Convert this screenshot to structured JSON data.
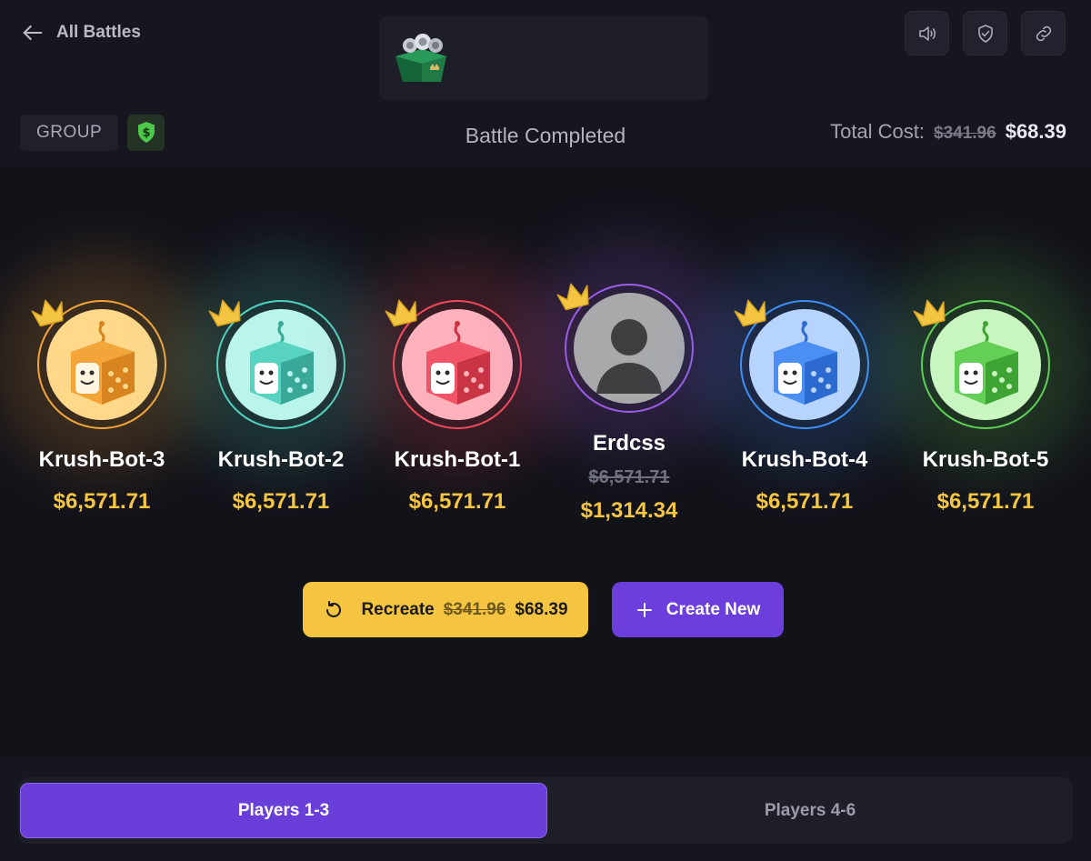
{
  "header": {
    "back_label": "All Battles",
    "mode_label": "GROUP",
    "status": "Battle Completed",
    "total_cost_label": "Total Cost:",
    "total_cost_original": "$341.96",
    "total_cost_price": "$68.39",
    "icons": [
      "volume-icon",
      "shield-check-icon",
      "link-icon"
    ],
    "money_badge_icon": "shield-dollar-icon",
    "case_image": "rolex-case-icon"
  },
  "players": [
    {
      "name": "Krush-Bot-3",
      "value": "$6,571.71",
      "color": "#f0a43a",
      "avatar": "orange-dice-bot"
    },
    {
      "name": "Krush-Bot-2",
      "value": "$6,571.71",
      "color": "#4fd1bf",
      "avatar": "teal-dice-bot"
    },
    {
      "name": "Krush-Bot-1",
      "value": "$6,571.71",
      "color": "#ef4a5c",
      "avatar": "red-dice-bot"
    },
    {
      "name": "Erdcss",
      "original_value": "$6,571.71",
      "value": "$1,314.34",
      "color": "#9b5de5",
      "avatar": "default-user"
    },
    {
      "name": "Krush-Bot-4",
      "value": "$6,571.71",
      "color": "#3f8ef5",
      "avatar": "blue-dice-bot"
    },
    {
      "name": "Krush-Bot-5",
      "value": "$6,571.71",
      "color": "#5fcf55",
      "avatar": "green-dice-bot"
    }
  ],
  "actions": {
    "recreate_label": "Recreate",
    "recreate_original": "$341.96",
    "recreate_price": "$68.39",
    "create_label": "Create New"
  },
  "tabs": [
    {
      "label": "Players 1-3",
      "active": true
    },
    {
      "label": "Players 4-6",
      "active": false
    }
  ]
}
